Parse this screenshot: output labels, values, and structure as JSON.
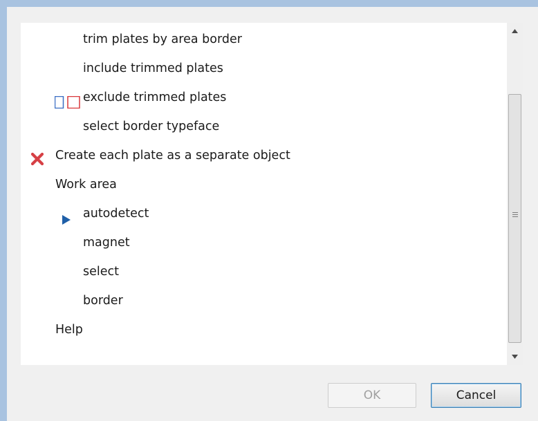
{
  "list": {
    "items": [
      {
        "label": "trim plates by area border",
        "level": 2,
        "icon": null
      },
      {
        "label": "include trimmed plates",
        "level": 2,
        "icon": null
      },
      {
        "label": "exclude trimmed plates",
        "level": 2,
        "icon": "checkbox-pair-icon"
      },
      {
        "label": "select border typeface",
        "level": 2,
        "icon": null
      },
      {
        "label": "Create each plate as a separate object",
        "level": 1,
        "icon": "red-x-icon"
      },
      {
        "label": "Work area",
        "level": 1,
        "icon": null
      },
      {
        "label": "autodetect",
        "level": 2,
        "icon": "play-arrow-icon"
      },
      {
        "label": "magnet",
        "level": 2,
        "icon": null
      },
      {
        "label": "select",
        "level": 2,
        "icon": null
      },
      {
        "label": "border",
        "level": 2,
        "icon": null
      },
      {
        "label": "Help",
        "level": 1,
        "icon": null
      }
    ]
  },
  "scrollbar": {
    "up_arrow_icon": "chevron-up-icon",
    "down_arrow_icon": "chevron-down-icon",
    "grip_icon": "grip-lines-icon"
  },
  "buttons": {
    "ok_label": "OK",
    "ok_enabled": false,
    "cancel_label": "Cancel"
  },
  "colors": {
    "window_frame": "#a9c3e0",
    "x_icon": "#d64045",
    "play_icon": "#1f5fa8",
    "checkbox_blue": "#3b6fc4",
    "checkbox_red": "#d9383c",
    "cancel_border": "#3c7fb1"
  }
}
